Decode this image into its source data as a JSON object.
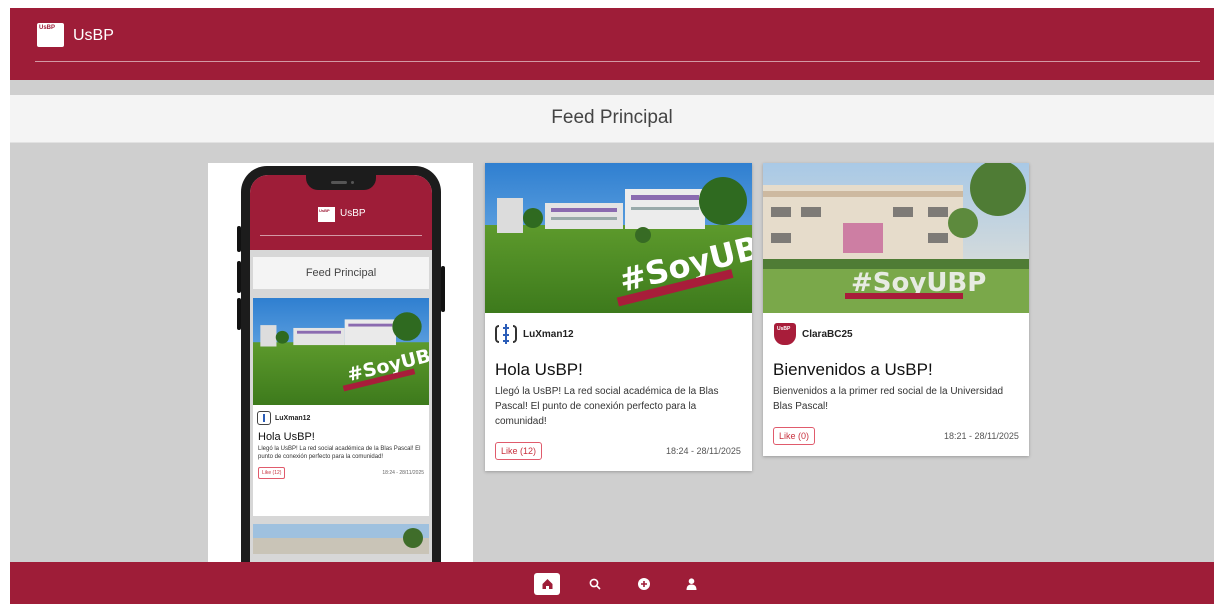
{
  "header": {
    "logo_text": "UsBP",
    "app_title": "UsBP"
  },
  "subheader": {
    "title": "Feed Principal"
  },
  "posts": [
    {
      "username": "LuXman12",
      "title": "Hola UsBP!",
      "body": "Llegó la UsBP! La red social académica de la Blas Pascal! El punto de conexión perfecto para la comunidad!",
      "like_label": "Like (12)",
      "timestamp": "18:24 - 28/11/2025",
      "image_text": "#SoyUBP",
      "avatar_icon": "usbp-bracket-logo-icon"
    },
    {
      "username": "ClaraBC25",
      "title": "Bienvenidos a UsBP!",
      "body": "Bienvenidos a la primer red social de la Universidad Blas Pascal!",
      "like_label": "Like (0)",
      "timestamp": "18:21 - 28/11/2025",
      "image_text": "#SoyUBP",
      "avatar_icon": "usbp-shield-logo-icon"
    }
  ],
  "phone_preview": {
    "logo_text": "UsBP",
    "app_title": "UsBP",
    "subheader": "Feed Principal",
    "post": {
      "username": "LuXman12",
      "title": "Hola UsBP!",
      "body": "Llegó la UsBP! La red social académica de la Blas Pascal! El punto de conexión perfecto para la comunidad!",
      "like_label": "Like (12)",
      "timestamp": "18:24 - 28/11/2025",
      "image_text": "#SoyUBP"
    }
  },
  "bottom_nav": [
    {
      "name": "home",
      "icon": "home-icon",
      "active": true
    },
    {
      "name": "search",
      "icon": "search-icon",
      "active": false
    },
    {
      "name": "create",
      "icon": "plus-circle-icon",
      "active": false
    },
    {
      "name": "profile",
      "icon": "user-icon",
      "active": false
    }
  ],
  "colors": {
    "brand": "#9e1d38",
    "like": "#c8323f",
    "background": "#cfcfcf"
  }
}
